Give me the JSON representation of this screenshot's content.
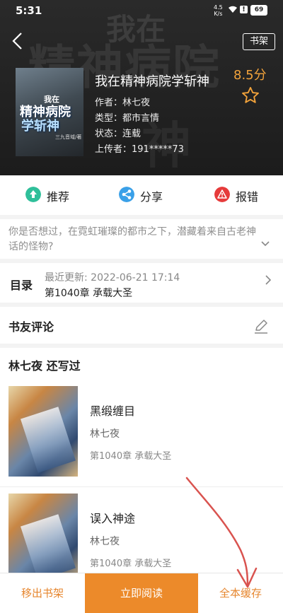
{
  "status_bar": {
    "time": "5:31",
    "speed_top": "4.5",
    "speed_bottom": "K/s",
    "battery": "69"
  },
  "header": {
    "back_icon": "chevron-left-icon",
    "shelf_label": "书架",
    "bg_text_main": "精神病院",
    "bg_text_top": "我在",
    "bg_text_bottom": "神",
    "cover": {
      "line1": "我在",
      "line2": "精神病院",
      "line3": "学斩神",
      "line4": "三九音域/著"
    }
  },
  "book": {
    "title": "我在精神病院学斩神",
    "author": "作者：林七夜",
    "type": "类型：都市言情",
    "status": "状态：连载",
    "uploader": "上传者：191*****73",
    "rating": "8.5分",
    "star_icon": "star-outline-icon"
  },
  "actions": {
    "recommend": "推荐",
    "share": "分享",
    "report": "报错"
  },
  "description": {
    "text": "你是否想过，在霓虹璀璨的都市之下，潜藏着来自古老神话的怪物?"
  },
  "toc": {
    "label": "目录",
    "updated": "最近更新:   2022-06-21 17:14",
    "chapter": "第1040章 承载大圣"
  },
  "comments": {
    "label": "书友评论"
  },
  "works": {
    "heading": "林七夜  还写过",
    "items": [
      {
        "title": "黑缎缠目",
        "author": "林七夜",
        "chapter": "第1040章 承载大圣"
      },
      {
        "title": "误入神途",
        "author": "林七夜",
        "chapter": "第1040章 承载大圣"
      }
    ]
  },
  "bottom": {
    "remove": "移出书架",
    "read": "立即阅读",
    "cache": "全本缓存"
  },
  "colors": {
    "accent": "#ec8a2a",
    "rating": "#f3a33b",
    "recommend": "#2fbf9a",
    "share": "#3aa0e8",
    "report": "#e63b3b"
  }
}
